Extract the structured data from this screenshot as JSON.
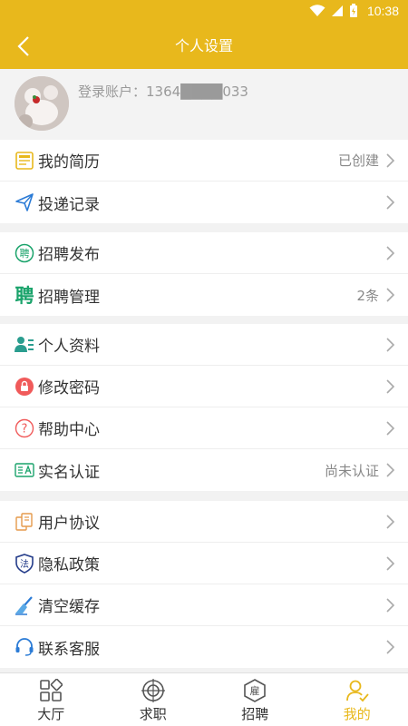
{
  "status": {
    "time": "10:38"
  },
  "header": {
    "title": "个人设置"
  },
  "profile": {
    "account": "登录账户：1364████033"
  },
  "groups": [
    {
      "items": [
        {
          "label": "我的简历",
          "value": "已创建",
          "icon": "resume-icon"
        },
        {
          "label": "投递记录",
          "value": "",
          "icon": "send-icon"
        }
      ]
    },
    {
      "items": [
        {
          "label": "招聘发布",
          "value": "",
          "icon": "recruit-publish-icon",
          "glyph": "聘"
        },
        {
          "label": "招聘管理",
          "value": "2条",
          "icon": "recruit-manage-icon",
          "glyph": "聘"
        }
      ]
    },
    {
      "items": [
        {
          "label": "个人资料",
          "value": "",
          "icon": "profile-card-icon"
        },
        {
          "label": "修改密码",
          "value": "",
          "icon": "lock-icon"
        },
        {
          "label": "帮助中心",
          "value": "",
          "icon": "help-icon"
        },
        {
          "label": "实名认证",
          "value": "尚未认证",
          "icon": "id-card-icon"
        }
      ]
    },
    {
      "items": [
        {
          "label": "用户协议",
          "value": "",
          "icon": "agreement-icon"
        },
        {
          "label": "隐私政策",
          "value": "",
          "icon": "privacy-shield-icon",
          "glyph": "法"
        },
        {
          "label": "清空缓存",
          "value": "",
          "icon": "broom-icon"
        },
        {
          "label": "联系客服",
          "value": "",
          "icon": "headset-icon"
        }
      ]
    }
  ],
  "tabs": [
    {
      "label": "大厅",
      "icon": "grid-icon"
    },
    {
      "label": "求职",
      "icon": "target-icon"
    },
    {
      "label": "招聘",
      "icon": "hire-badge-icon",
      "glyph": "雇"
    },
    {
      "label": "我的",
      "icon": "user-check-icon",
      "active": true
    }
  ],
  "colors": {
    "accent": "#e8b81c",
    "green": "#1aa36b",
    "red": "#f05a5a",
    "blue": "#2b7bd6"
  }
}
